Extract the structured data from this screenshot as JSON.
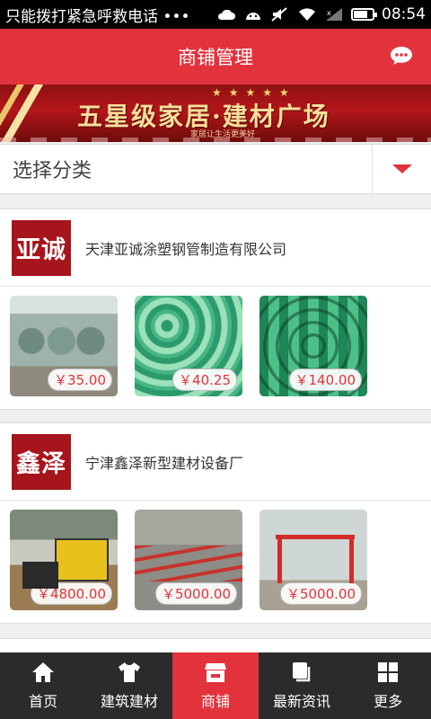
{
  "status_bar": {
    "notification_text": "只能拨打紧急呼救电话 •••",
    "time": "08:54",
    "icons": [
      "cloud-icon",
      "android-icon",
      "mute-icon",
      "wifi-icon",
      "signal-icon",
      "battery-icon"
    ]
  },
  "header": {
    "title": "商铺管理",
    "action_icon": "chat-icon"
  },
  "banner": {
    "headline": "五星级家居·建材广场",
    "tagline": "家居让生活更美好",
    "stars": "★★★★★"
  },
  "selector": {
    "label": "选择分类",
    "icon": "dropdown-triangle-icon"
  },
  "shops": [
    {
      "logo_text": "亚诚",
      "name": "天津亚诚涂塑钢管制造有限公司",
      "products": [
        {
          "price": "￥35.00"
        },
        {
          "price": "￥40.25"
        },
        {
          "price": "￥140.00"
        }
      ]
    },
    {
      "logo_text": "鑫泽",
      "name": "宁津鑫泽新型建材设备厂",
      "products": [
        {
          "price": "￥4800.00"
        },
        {
          "price": "￥5000.00"
        },
        {
          "price": "￥5000.00"
        }
      ]
    }
  ],
  "bottom_nav": {
    "items": [
      {
        "label": "首页",
        "icon": "home-icon",
        "active": false
      },
      {
        "label": "建筑建材",
        "icon": "tshirt-icon",
        "active": false
      },
      {
        "label": "商铺",
        "icon": "shop-icon",
        "active": true
      },
      {
        "label": "最新资讯",
        "icon": "news-icon",
        "active": false
      },
      {
        "label": "更多",
        "icon": "grid-icon",
        "active": false
      }
    ]
  },
  "colors": {
    "accent": "#e2333c",
    "nav_bg": "#2b2b2b",
    "logo_bg": "#a6151c"
  }
}
